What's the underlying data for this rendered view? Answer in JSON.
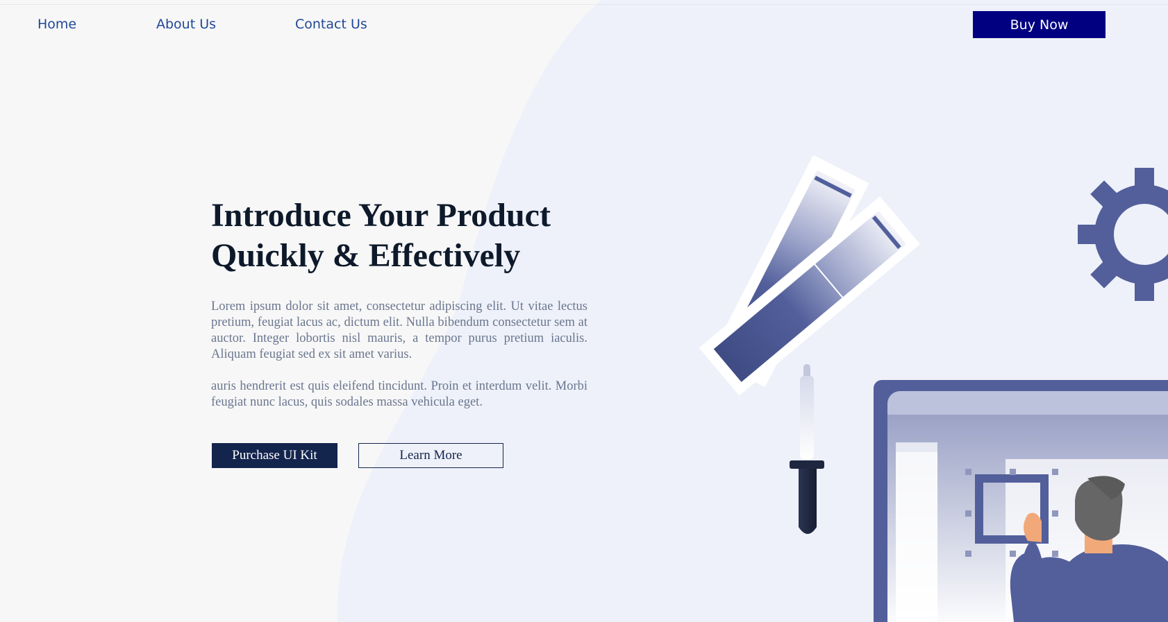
{
  "nav": {
    "home": "Home",
    "about": "About Us",
    "contact": "Contact Us",
    "buy_now": "Buy Now"
  },
  "hero": {
    "title_line1": "Introduce Your Product",
    "title_line2": "Quickly & Effectively",
    "paragraph1": "Lorem ipsum dolor sit amet, consectetur adipiscing elit. Ut vitae lectus pretium, feugiat lacus ac, dictum elit. Nulla bibendum consectetur sem at auctor. Integer lobortis nisl mauris, a tempor purus pretium iaculis. Aliquam feugiat sed ex sit amet varius.",
    "paragraph2": "auris hendrerit est quis eleifend tincidunt. Proin et interdum velit. Morbi feugiat nunc lacus, quis sodales massa vehicula eget.",
    "primary_button": "Purchase UI Kit",
    "secondary_button": "Learn More"
  },
  "illustration": {
    "icons": [
      "color-swatches-icon",
      "gear-icon",
      "eyedropper-icon",
      "monitor-icon",
      "person-icon"
    ]
  },
  "colors": {
    "nav_link": "#1f4797",
    "buy_button": "#000080",
    "title": "#0e1a2b",
    "body_text": "#6a768f",
    "primary_button": "#13244d",
    "illustration_blue": "#525f9b",
    "blob": "#eef1f9"
  }
}
